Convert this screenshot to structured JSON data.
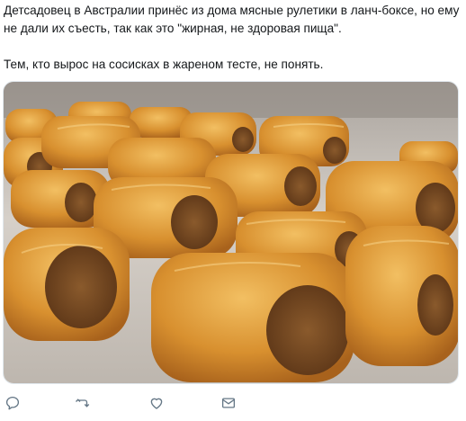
{
  "tweet": {
    "text_line_1": "Детсадовец в Австралии принёс из дома мясные рулетики в ланч-боксе, но ему не дали их съесть, так как это \"жирная, не здоровая пища\".",
    "text_line_2": "Тем, кто вырос на сосисках в жареном тесте, не понять."
  },
  "media": {
    "icon": "photo-sausage-rolls"
  },
  "actions": [
    {
      "name": "reply",
      "icon": "reply-icon"
    },
    {
      "name": "retweet",
      "icon": "retweet-icon"
    },
    {
      "name": "like",
      "icon": "heart-icon"
    },
    {
      "name": "message",
      "icon": "envelope-icon"
    }
  ],
  "colors": {
    "text": "#14171a",
    "icon": "#657786",
    "pastry": "#d99a3c",
    "filling": "#7a4a22",
    "tray": "#cfc9c2"
  }
}
